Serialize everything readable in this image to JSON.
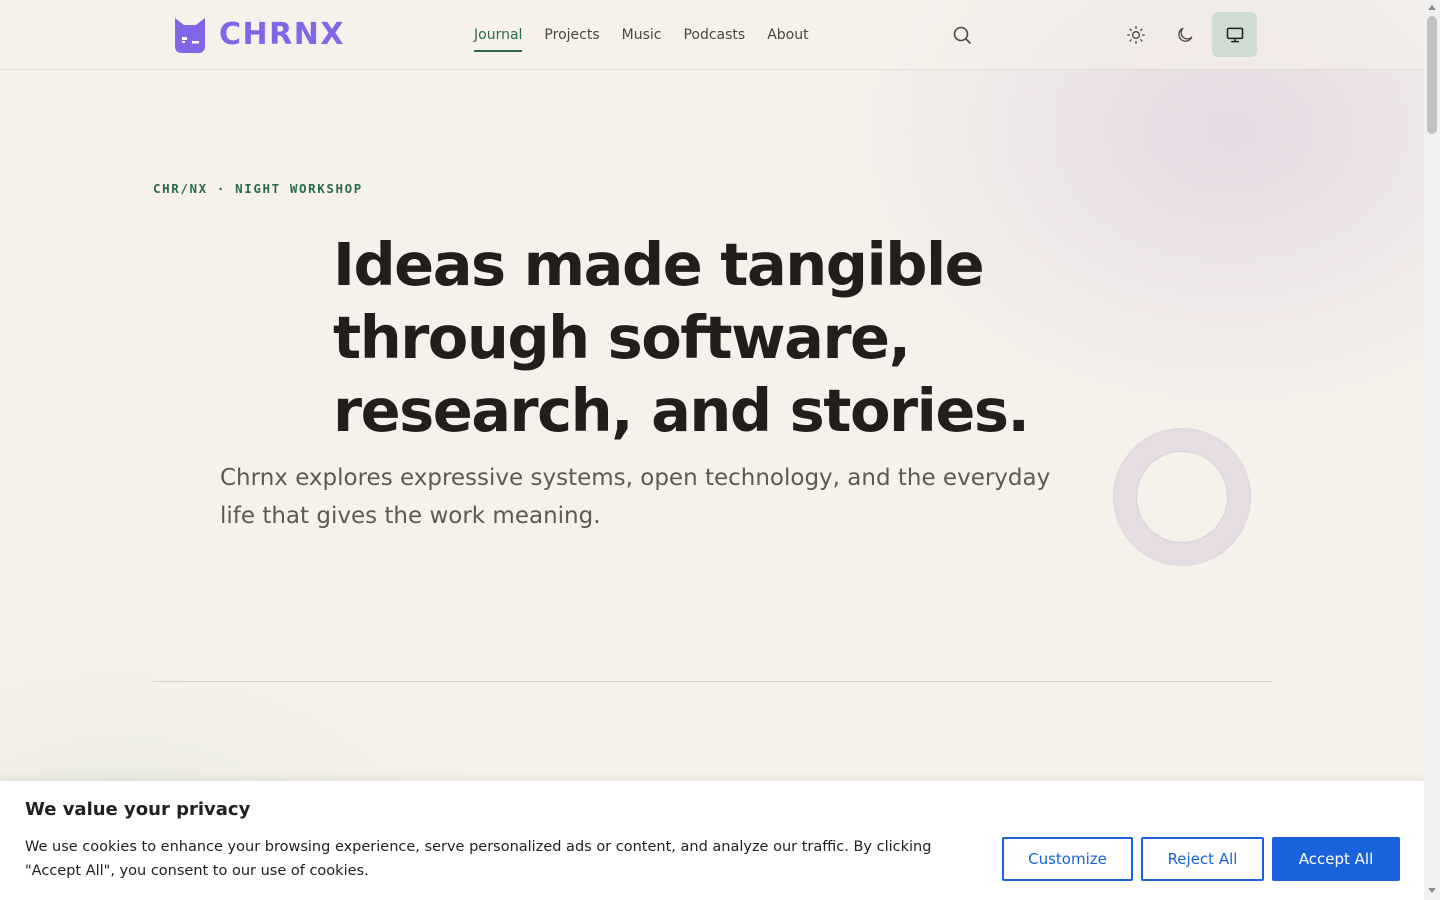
{
  "brand": {
    "name": "CHRNX",
    "color": "#7f67e8"
  },
  "nav": {
    "items": [
      {
        "label": "Journal",
        "active": true
      },
      {
        "label": "Projects",
        "active": false
      },
      {
        "label": "Music",
        "active": false
      },
      {
        "label": "Podcasts",
        "active": false
      },
      {
        "label": "About",
        "active": false
      }
    ]
  },
  "header_actions": {
    "search_icon": "search-icon",
    "theme_options": [
      {
        "icon": "sun-icon",
        "selected": false
      },
      {
        "icon": "moon-icon",
        "selected": false
      },
      {
        "icon": "monitor-icon",
        "selected": true
      }
    ]
  },
  "hero": {
    "eyebrow": "CHR/NX · NIGHT WORKSHOP",
    "headline": "Ideas made tangible through software, research, and stories.",
    "lede": "Chrnx explores expressive systems, open technology, and the everyday life that gives the work meaning."
  },
  "cookie_banner": {
    "title": "We value your privacy",
    "text": "We use cookies to enhance your browsing experience, serve personalized ads or content, and analyze our traffic. By clicking \"Accept All\", you consent to our use of cookies.",
    "customize_label": "Customize",
    "reject_label": "Reject All",
    "accept_label": "Accept All",
    "accent_color": "#1863dc"
  },
  "colors": {
    "background": "#f6f2eb",
    "accent_green": "#2c6b4a",
    "text": "#221e1c"
  }
}
